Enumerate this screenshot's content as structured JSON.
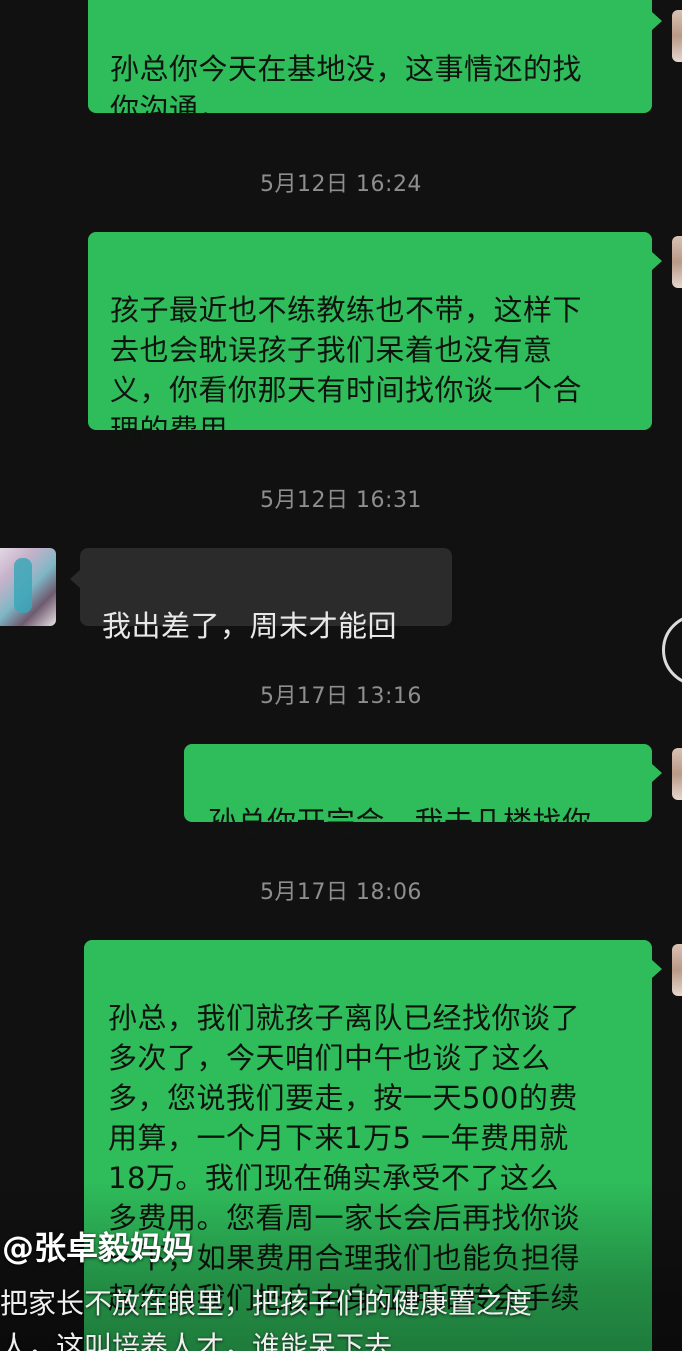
{
  "chat": {
    "messages": [
      {
        "type": "sent",
        "text": "孙总你今天在基地没，这事情还的找\n你沟通，"
      },
      {
        "type": "time",
        "text": "5月12日 16:24"
      },
      {
        "type": "sent",
        "text": "孩子最近也不练教练也不带，这样下\n去也会耽误孩子我们呆着也没有意\n义，你看你那天有时间找你谈一个合\n理的费用"
      },
      {
        "type": "time",
        "text": "5月12日 16:31"
      },
      {
        "type": "recv",
        "text": "我出差了，周末才能回"
      },
      {
        "type": "time",
        "text": "5月17日 13:16"
      },
      {
        "type": "sent",
        "text": "孙总你开完会，我去几楼找你"
      },
      {
        "type": "time",
        "text": "5月17日 18:06"
      },
      {
        "type": "sent",
        "text": "孙总，我们就孩子离队已经找你谈了\n多次了，今天咱们中午也谈了这么\n多，您说我们要走，按一天500的费\n用算，一个月下来1万5 一年费用就\n18万。我们现在确实承受不了这么\n多费用。您看周一家长会后再找你谈\n一下，如果费用合理我们也能负担得\n起您给我们把自由身证明和转会手续"
      }
    ]
  },
  "overlay": {
    "handle": "@张卓毅妈妈",
    "line1": "把家长不放在眼里，把孩子们的健康置之度",
    "line2": "人，这叫培养人才，谁能呆下去"
  },
  "colors": {
    "background": "#111111",
    "sent_bubble": "#2fbd5b",
    "recv_bubble": "#2b2b2b",
    "timestamp": "#8e8e8e"
  },
  "icons": {
    "right_avatar": "user-avatar",
    "left_avatar": "contact-avatar",
    "side_control": "circle-control-icon"
  }
}
